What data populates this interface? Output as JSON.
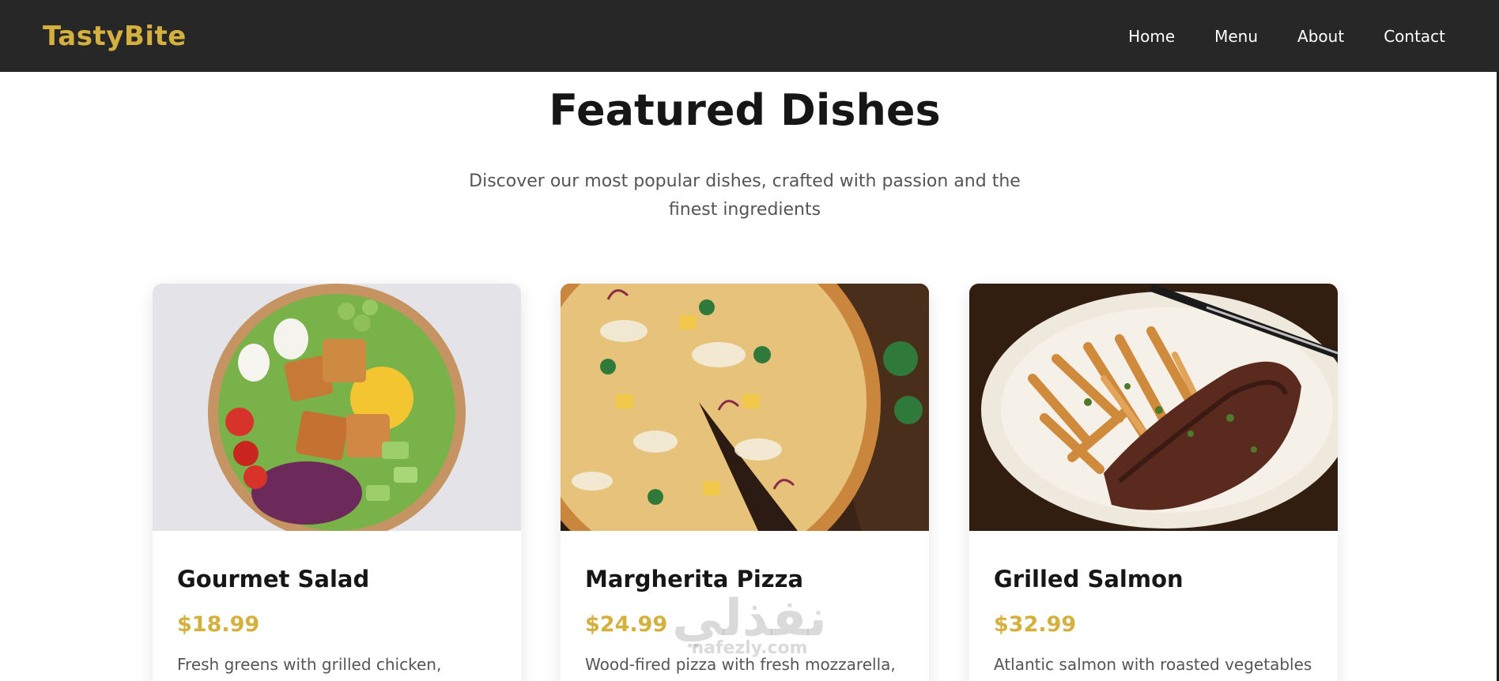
{
  "nav": {
    "logo": "TastyBite",
    "links": [
      "Home",
      "Menu",
      "About",
      "Contact"
    ]
  },
  "section": {
    "title": "Featured Dishes",
    "subtitle": "Discover our most popular dishes, crafted with passion and the finest ingredients"
  },
  "cards": [
    {
      "title": "Gourmet Salad",
      "price": "$18.99",
      "description": "Fresh greens with grilled chicken,",
      "image": "salad-bowl-photo"
    },
    {
      "title": "Margherita Pizza",
      "price": "$24.99",
      "description": "Wood-fired pizza with fresh mozzarella,",
      "image": "pizza-photo"
    },
    {
      "title": "Grilled Salmon",
      "price": "$32.99",
      "description": "Atlantic salmon with roasted vegetables",
      "image": "steak-fries-photo"
    }
  ],
  "watermark": {
    "arabic": "نفذلي",
    "latin": "nafezly.com"
  },
  "colors": {
    "nav_bg": "#272727",
    "accent": "#d4b03e",
    "title": "#161616",
    "muted": "#555555"
  }
}
